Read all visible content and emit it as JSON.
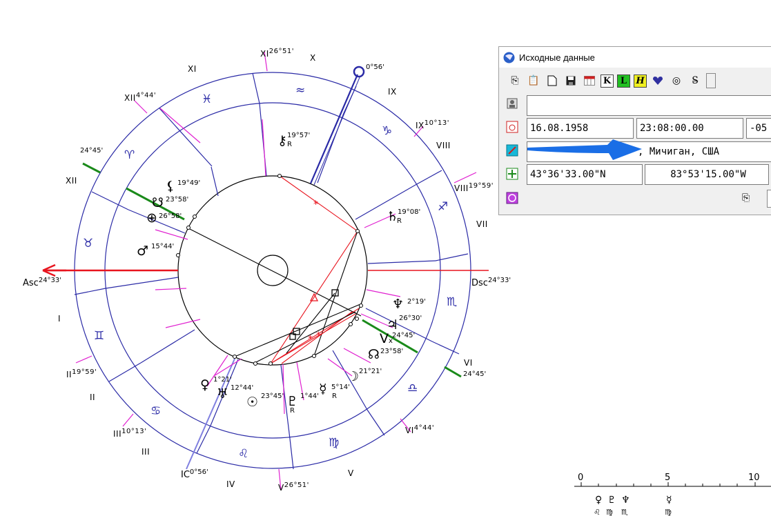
{
  "chart": {
    "asc_label": "Asc",
    "asc_degree": "24°33'",
    "dsc_label": "Dsc",
    "dsc_degree": "24°33'",
    "mc_degree": "0°56'",
    "ic_label": "IC",
    "ic_degree": "0°56'",
    "outer_numerals": [
      {
        "label": "XI",
        "degree": "26°51'"
      },
      {
        "label": "XII",
        "degree": "4°44'"
      },
      {
        "label": "IX",
        "degree": "10°13'"
      },
      {
        "label": "VIII",
        "degree": "19°59'"
      },
      {
        "label": "II",
        "degree": "19°59'"
      },
      {
        "label": "III",
        "degree": "10°13'"
      },
      {
        "label": "VI",
        "degree": "4°44'"
      },
      {
        "label": "V",
        "degree": "26°51'"
      }
    ],
    "house_numbers": [
      "X",
      "XI",
      "IX",
      "XII",
      "VIII",
      "VII",
      "I",
      "II",
      "VI",
      "III",
      "V",
      "IV"
    ],
    "planets": [
      {
        "glyph": "☊",
        "degree": "19°57'",
        "retro": "R",
        "name": "chiron"
      },
      {
        "glyph": "⚸",
        "degree": "19°49'",
        "retro": "",
        "name": "lilith"
      },
      {
        "glyph": "☋",
        "degree": "23°58'",
        "retro": "",
        "name": "south-node"
      },
      {
        "glyph": "⊗",
        "degree": "26°58'",
        "retro": "",
        "name": "fortune"
      },
      {
        "glyph": "♂",
        "degree": "15°44'",
        "retro": "",
        "name": "mars"
      },
      {
        "glyph": "♄",
        "degree": "19°08'",
        "retro": "R",
        "name": "saturn"
      },
      {
        "glyph": "♆",
        "degree": "2°19'",
        "retro": "",
        "name": "neptune"
      },
      {
        "glyph": "♃",
        "degree": "26°30'",
        "retro": "",
        "name": "jupiter"
      },
      {
        "glyph": "Vx",
        "degree": "24°45'",
        "retro": "",
        "name": "vertex"
      },
      {
        "glyph": "☊",
        "degree": "23°58'",
        "retro": "",
        "name": "north-node"
      },
      {
        "glyph": "☽",
        "degree": "21°21'",
        "retro": "",
        "name": "moon"
      },
      {
        "glyph": "☿",
        "degree": "5°14'",
        "retro": "R",
        "name": "mercury"
      },
      {
        "glyph": "♀",
        "degree": "1°21'",
        "retro": "",
        "name": "venus"
      },
      {
        "glyph": "♅",
        "degree": "12°44'",
        "retro": "",
        "name": "uranus"
      },
      {
        "glyph": "☉",
        "degree": "23°45'",
        "retro": "",
        "name": "sun"
      },
      {
        "glyph": "♇",
        "degree": "1°44'",
        "retro": "R",
        "name": "pluto"
      }
    ],
    "left_axis_degree": "24°45'",
    "right_axis_degree": "24°45'"
  },
  "dialog": {
    "title": "Исходные данные",
    "toolbar_letters": [
      "K",
      "L",
      "H"
    ],
    "name_value": "",
    "date": "16.08.1958",
    "time": "23:08:00.00",
    "timezone": "-05",
    "place": ", Мичиган, США",
    "latitude": "43°36'33.00\"N",
    "longitude": "83°53'15.00\"W"
  },
  "scale": {
    "labels": [
      "0",
      "5",
      "10"
    ],
    "glyphs_top": [
      "♀",
      "♇",
      "♆",
      "☿"
    ],
    "glyphs_bottom": [
      "♌",
      "♍",
      "♏",
      "♍"
    ]
  },
  "colors": {
    "house_line": "#2a2aa6",
    "axis_red": "#e8141e",
    "aspect_red": "#e8141e",
    "magenta": "#e020d0",
    "green": "#1a8a1a",
    "arrow_blue": "#1a6ee6"
  }
}
